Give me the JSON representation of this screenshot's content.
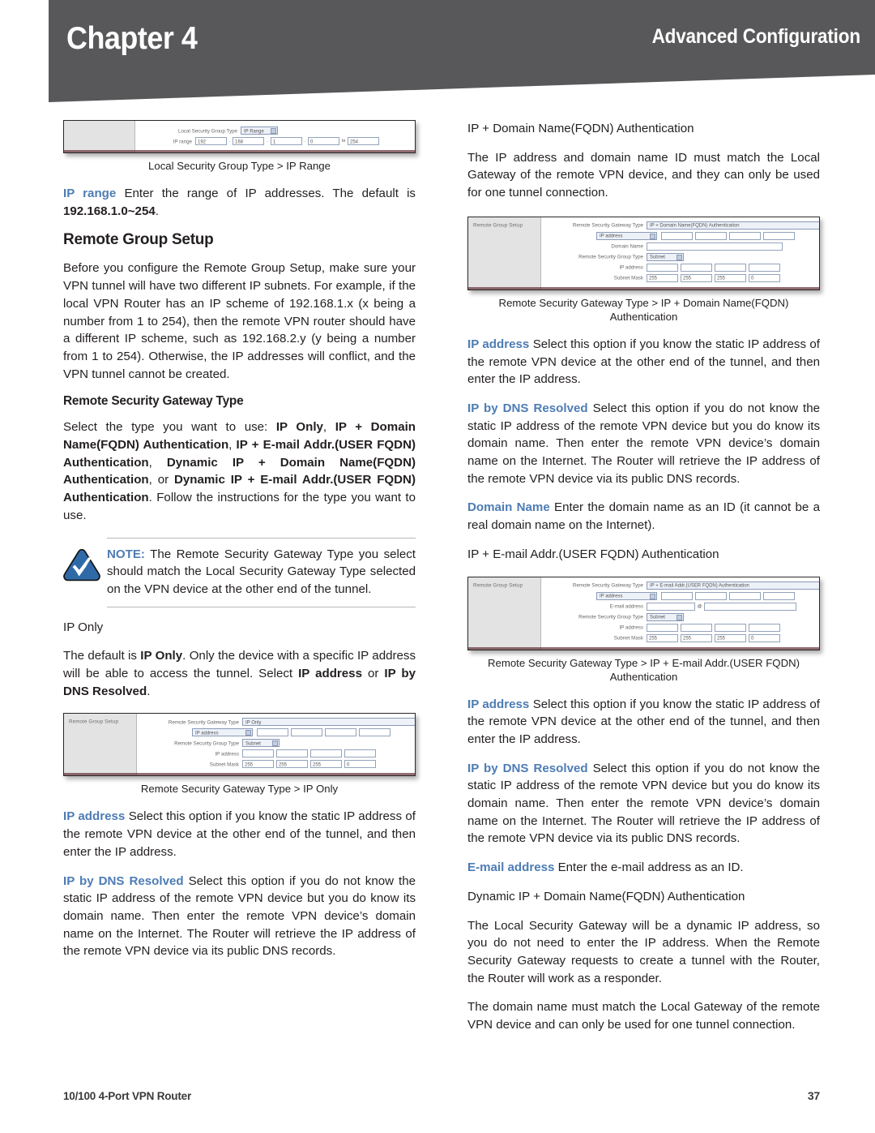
{
  "header": {
    "chapter": "Chapter 4",
    "section": "Advanced Configuration"
  },
  "footer": {
    "product": "10/100 4-Port VPN Router",
    "page_number": "37"
  },
  "left_column": {
    "figure_ip_range": {
      "panel_label": "",
      "rows": {
        "local_security_group_type_label": "Local Security Group Type",
        "local_security_group_type_value": "IP Range",
        "ip_range_label": "IP range",
        "oct1": "192",
        "oct2": "168",
        "oct3": "1",
        "oct4": "0",
        "to_label": "to",
        "oct_end": "254"
      },
      "caption": "Local Security Group Type > IP Range"
    },
    "ip_range_desc": {
      "lead": "IP range",
      "text": " Enter the range of IP addresses. The default is ",
      "bold_value": "192.168.1.0~254",
      "tail": "."
    },
    "remote_group_setup_heading": "Remote Group Setup",
    "remote_group_setup_body": "Before you configure the Remote Group Setup, make sure your VPN tunnel will have two different IP subnets. For example, if the local VPN Router has an IP scheme of 192.168.1.x (x being a number from 1 to 254), then the remote VPN router should have a different IP scheme, such as 192.168.2.y (y being a number from 1 to 254). Otherwise, the IP addresses will conflict, and the VPN tunnel cannot be created.",
    "remote_security_gateway_type_heading": "Remote Security Gateway Type",
    "type_select_intro": "Select the type you want to use: ",
    "type_options": [
      "IP Only",
      "IP + Domain Name(FQDN) Authentication",
      "IP + E-mail Addr.(USER FQDN) Authentication",
      "Dynamic IP + Domain Name(FQDN) Authentication",
      "Dynamic IP + E-mail Addr.(USER FQDN) Authentication"
    ],
    "type_select_outro": ". Follow the instructions for the type you want to use.",
    "note": {
      "label": "NOTE:",
      "text": " The Remote Security Gateway Type you select should match the Local Security Gateway Type selected on the VPN device at the other end of the tunnel."
    },
    "ip_only_heading": "IP Only",
    "ip_only_body_1": "The default is ",
    "ip_only_bold_1": "IP Only",
    "ip_only_body_2": ". Only the device with a specific IP address will be able to access the tunnel. Select ",
    "ip_only_bold_2": "IP address",
    "ip_only_body_3": " or ",
    "ip_only_bold_3": "IP by DNS Resolved",
    "ip_only_body_4": ".",
    "figure_ip_only": {
      "panel_label": "Remote Group Setup",
      "rows": {
        "gateway_type_label": "Remote Security Gateway Type",
        "gateway_type_value": "IP Only",
        "ip_address_select": "IP address",
        "group_type_label": "Remote Security Group Type",
        "group_type_value": "Subnet",
        "ip_address_label": "IP address",
        "subnet_mask_label": "Subnet Mask",
        "mask": [
          "255",
          "255",
          "255",
          "0"
        ]
      },
      "caption": "Remote Security Gateway Type > IP Only"
    },
    "ip_address_desc": {
      "lead": "IP address",
      "text": " Select this option if you know the static IP address of the remote VPN device at the other end of the tunnel, and then enter the IP address."
    },
    "ip_by_dns_desc": {
      "lead": "IP by DNS Resolved",
      "text": " Select this option if you do not know the static IP address of the remote VPN device but you do know its domain name. Then enter the remote VPN device’s domain name on the Internet. The Router will retrieve the IP address of the remote VPN device via its public DNS records."
    }
  },
  "right_column": {
    "heading_ip_domain": "IP + Domain Name(FQDN) Authentication",
    "intro_ip_domain": "The IP address and domain name ID must match the Local Gateway of the remote VPN device, and they can only be used for one tunnel connection.",
    "figure_ip_domain": {
      "panel_label": "Remote Group Setup",
      "rows": {
        "gateway_type_label": "Remote Security Gateway Type",
        "gateway_type_value": "IP + Domain Name(FQDN) Authentication",
        "ip_address_select": "IP address",
        "domain_name_label": "Domain Name",
        "group_type_label": "Remote Security Group Type",
        "group_type_value": "Subnet",
        "ip_address_label": "IP address",
        "subnet_mask_label": "Subnet Mask",
        "mask": [
          "255",
          "255",
          "255",
          "0"
        ]
      },
      "caption": "Remote Security Gateway Type > IP + Domain Name(FQDN) Authentication"
    },
    "ip_address_desc": {
      "lead": "IP address",
      "text": " Select this option if you know the static IP address of the remote VPN device at the other end of the tunnel, and then enter the IP address."
    },
    "ip_by_dns_desc": {
      "lead": "IP by DNS Resolved",
      "text": " Select this option if you do not know the static IP address of the remote VPN device but you do know its domain name. Then enter the remote VPN device’s domain name on the Internet. The Router will retrieve the IP address of the remote VPN device via its public DNS records."
    },
    "domain_name_desc": {
      "lead": "Domain Name",
      "text": "  Enter the domain name as an ID (it cannot be a real domain name on the Internet)."
    },
    "heading_ip_email": "IP + E-mail Addr.(USER FQDN) Authentication",
    "figure_ip_email": {
      "panel_label": "Remote Group Setup",
      "rows": {
        "gateway_type_label": "Remote Security Gateway Type",
        "gateway_type_value": "IP + E-mail Addr.(USER FQDN) Authentication",
        "ip_address_select": "IP address",
        "email_address_label": "E-mail address",
        "at_symbol": "@",
        "group_type_label": "Remote Security Group Type",
        "group_type_value": "Subnet",
        "ip_address_label": "IP address",
        "subnet_mask_label": "Subnet Mask",
        "mask": [
          "255",
          "255",
          "255",
          "0"
        ]
      },
      "caption": "Remote Security Gateway Type > IP + E-mail Addr.(USER FQDN) Authentication"
    },
    "ip_address_desc_2": {
      "lead": "IP address",
      "text": " Select this option if you know the static IP address of the remote VPN device at the other end of the tunnel, and then enter the IP address."
    },
    "ip_by_dns_desc_2": {
      "lead": "IP by DNS Resolved",
      "text": " Select this option if you do not know the static IP address of the remote VPN device but you do know its domain name. Then enter the remote VPN device’s domain name on the Internet. The Router will retrieve the IP address of the remote VPN device via its public DNS records."
    },
    "email_address_desc": {
      "lead": "E-mail address",
      "text": "  Enter the e-mail address as an ID."
    },
    "heading_dynamic_ip_domain": "Dynamic IP + Domain Name(FQDN) Authentication",
    "dynamic_body_1": "The Local Security Gateway will be a dynamic IP address, so you do not need to enter the IP address. When the Remote Security Gateway requests to create a tunnel with the Router, the Router will work as a responder.",
    "dynamic_body_2": "The domain name must match the Local Gateway of the remote VPN device and can only be used for one tunnel connection."
  },
  "colors": {
    "header_gray": "#58585a",
    "accent_blue": "#4d7cb4",
    "text": "#231f20"
  }
}
